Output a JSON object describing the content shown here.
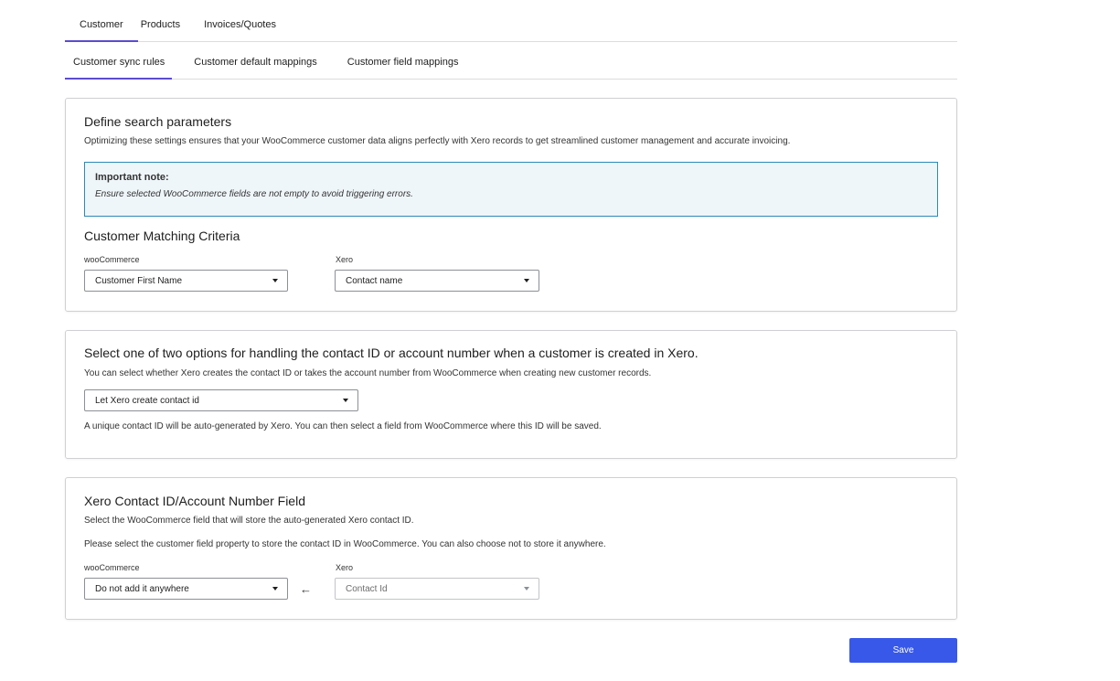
{
  "top_tabs": [
    {
      "label": "Customer",
      "active": true
    },
    {
      "label": "Products",
      "active": false
    },
    {
      "label": "Invoices/Quotes",
      "active": false
    }
  ],
  "sub_tabs": [
    {
      "label": "Customer sync rules",
      "active": true
    },
    {
      "label": "Customer default mappings",
      "active": false
    },
    {
      "label": "Customer field mappings",
      "active": false
    }
  ],
  "search_params": {
    "title": "Define search parameters",
    "description": "Optimizing these settings ensures that your WooCommerce customer data aligns perfectly with Xero records to get streamlined customer management and accurate invoicing.",
    "note_title": "Important note:",
    "note_text": "Ensure selected WooCommerce fields are not empty to avoid triggering errors.",
    "matching_title": "Customer Matching Criteria",
    "woo_label": "wooCommerce",
    "woo_value": "Customer First Name",
    "xero_label": "Xero",
    "xero_value": "Contact name"
  },
  "contact_options": {
    "title": "Select one of two options for handling the contact ID or account number when a customer is created in Xero.",
    "description": "You can select whether Xero creates the contact ID or takes the account number from WooCommerce when creating new customer records.",
    "select_value": "Let Xero create contact id",
    "help": "A unique contact ID will be auto-generated by Xero. You can then select a field from WooCommerce where this ID will be saved."
  },
  "contact_field": {
    "title": "Xero Contact ID/Account Number Field",
    "description": "Select the WooCommerce field that will store the auto-generated Xero contact ID.",
    "description2": "Please select the customer field property to store the contact ID in WooCommerce. You can also choose not to store it anywhere.",
    "woo_label": "wooCommerce",
    "woo_value": "Do not add it anywhere",
    "arrow": "←",
    "xero_label": "Xero",
    "xero_value": "Contact Id"
  },
  "save_label": "Save",
  "colors": {
    "accent": "#5b4ccf",
    "primary_button": "#3858e9",
    "note_border": "#2a8ab8",
    "note_bg": "#eff6fa"
  }
}
